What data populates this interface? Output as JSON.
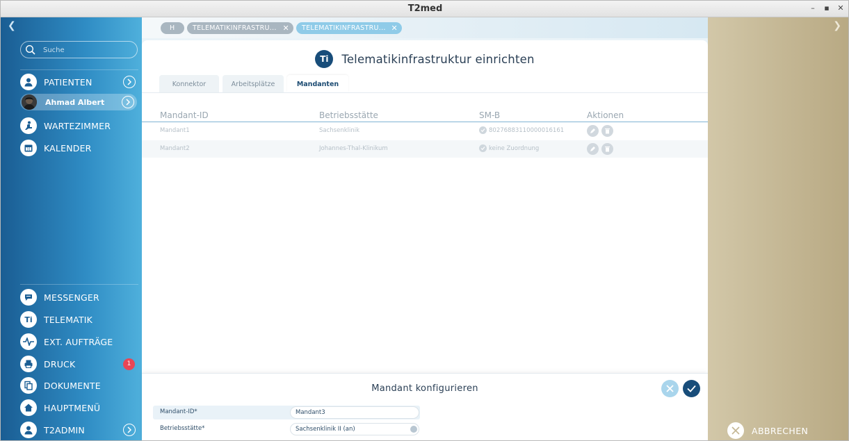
{
  "window": {
    "title": "T2med"
  },
  "sidebar": {
    "search_placeholder": "Suche",
    "patients_label": "PATIENTEN",
    "current_patient": "Ahmad Albert",
    "waiting_room": "WARTEZIMMER",
    "calendar": "KALENDER",
    "messenger": "MESSENGER",
    "telematik": "TELEMATIK",
    "ext_orders": "EXT. AUFTRÄGE",
    "print": "DRUCK",
    "print_badge": "1",
    "documents": "DOKUMENTE",
    "main_menu": "HAUPTMENÜ",
    "t2admin": "T2ADMIN"
  },
  "top_tabs": [
    {
      "label": "H"
    },
    {
      "label": "TELEMATIKINFRASTRU..."
    },
    {
      "label": "TELEMATIKINFRASTRU..."
    }
  ],
  "panel": {
    "icon_text": "Ti",
    "title": "Telematikinfrastruktur einrichten",
    "subtabs": [
      "Konnektor",
      "Arbeitsplätze",
      "Mandanten"
    ],
    "active_subtab": "Mandanten",
    "columns": [
      "Mandant-ID",
      "Betriebsstätte",
      "SM-B",
      "Aktionen"
    ],
    "rows": [
      {
        "id": "Mandant1",
        "site": "Sachsenklinik",
        "smb": "80276883110000016161"
      },
      {
        "id": "Mandant2",
        "site": "Johannes-Thal-Klinikum",
        "smb": "keine Zuordnung"
      }
    ]
  },
  "config": {
    "title": "Mandant konfigurieren",
    "fields": [
      {
        "label": "Mandant-ID*",
        "value": "Mandant3"
      },
      {
        "label": "Betriebsstätte*",
        "value": "Sachsenklinik II (an)"
      }
    ]
  },
  "right": {
    "abort_label": "ABBRECHEN"
  },
  "colors": {
    "primary": "#184d7a",
    "sidebar": "#2f8cc4",
    "badge": "#e84656",
    "right_panel": "#c4b794"
  }
}
